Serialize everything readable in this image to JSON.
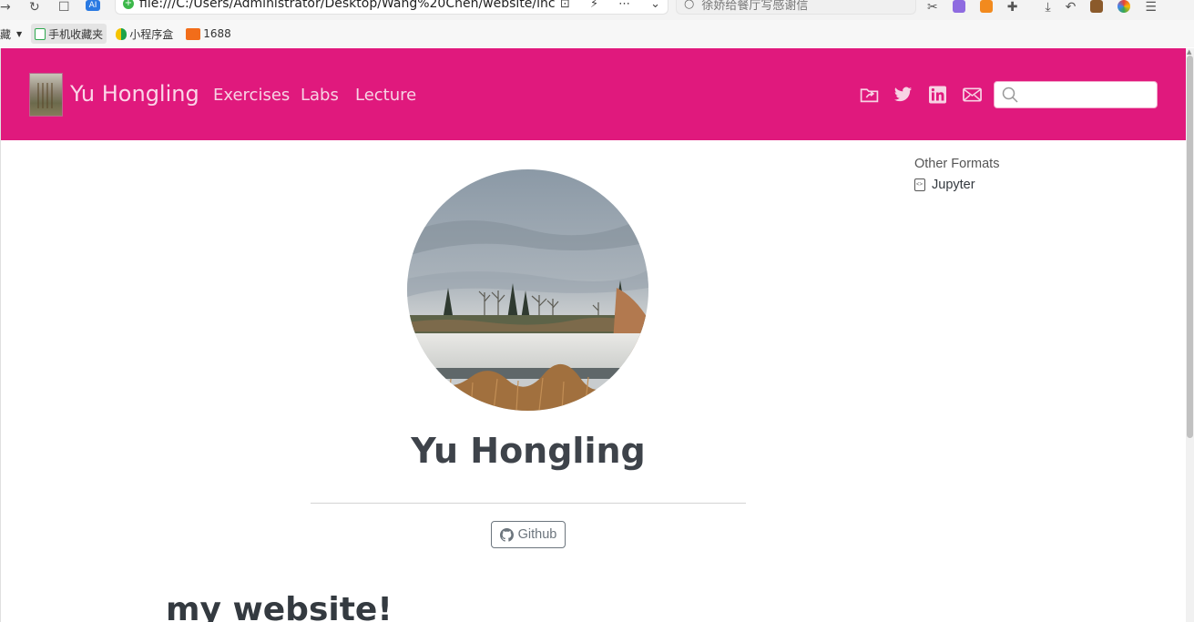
{
  "browser": {
    "url": "file:///C:/Users/Administrator/Desktop/Wang%20Chen/website/inc",
    "search_placeholder": "徐娇给餐厅写感谢信",
    "bookmarks": [
      {
        "label": "藏",
        "icon": "folder-icon"
      },
      {
        "label": "手机收藏夹",
        "icon": "phone-icon"
      },
      {
        "label": "小程序盒",
        "icon": "shield-icon"
      },
      {
        "label": "1688",
        "icon": "1688-logo-icon"
      }
    ]
  },
  "site": {
    "brand": "Yu Hongling",
    "nav_links": [
      "Exercises",
      "Labs",
      "Lecture"
    ],
    "nav_icons": [
      "folder-share-icon",
      "twitter-icon",
      "linkedin-icon",
      "envelope-icon"
    ],
    "search_placeholder": ""
  },
  "sidebar": {
    "heading": "Other Formats",
    "formats": [
      {
        "label": "Jupyter",
        "icon": "notebook-icon"
      }
    ]
  },
  "profile": {
    "name": "Yu Hongling",
    "links": [
      {
        "label": "Github",
        "icon": "github-icon"
      }
    ]
  },
  "content": {
    "heading": "my website!"
  },
  "colors": {
    "navbar": "#e0197d",
    "nav_text": "#f7d3e4",
    "text": "#343a40"
  }
}
